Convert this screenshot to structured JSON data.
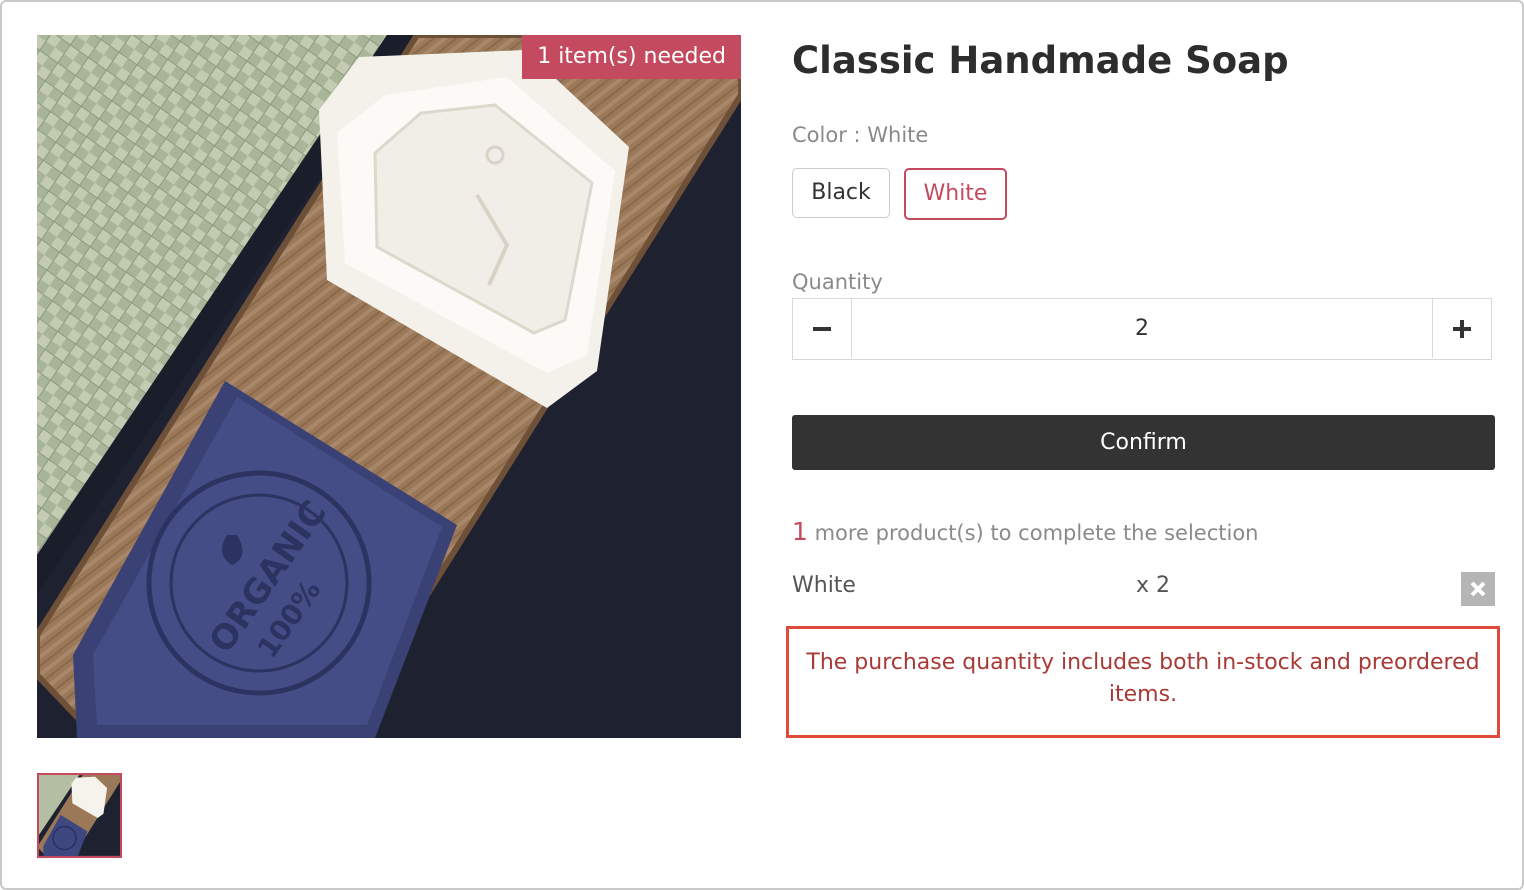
{
  "product": {
    "title": "Classic Handmade Soap",
    "badge": "1 item(s) needed",
    "image_icon": "soap-photo",
    "thumbnail_icon": "soap-thumbnail"
  },
  "color": {
    "label": "Color : White",
    "options": [
      "Black",
      "White"
    ],
    "selected": "White"
  },
  "quantity": {
    "label": "Quantity",
    "value": "2",
    "minus_icon": "minus-icon",
    "plus_icon": "plus-icon"
  },
  "actions": {
    "confirm_label": "Confirm"
  },
  "selection": {
    "remaining_count": "1",
    "remaining_text": " more product(s) to complete the selection",
    "items": [
      {
        "name": "White",
        "qty": "x 2"
      }
    ],
    "remove_icon": "close-icon"
  },
  "notice": "The purchase quantity includes both in-stock and preordered items.",
  "colors": {
    "accent": "#c44b5f",
    "button_dark": "#333333",
    "notice_border": "#e04a3a",
    "notice_text": "#a83a36"
  }
}
